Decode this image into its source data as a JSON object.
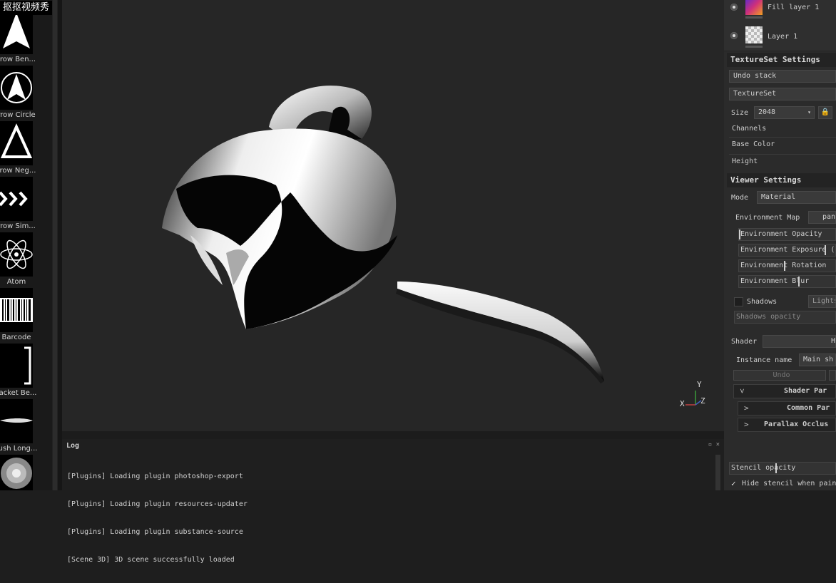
{
  "watermark": "抠抠视频秀",
  "shelf": {
    "items": [
      {
        "label": "rrow Ben...",
        "icon": "arrow-bend-icon"
      },
      {
        "label": "rrow Circle",
        "icon": "arrow-circle-icon"
      },
      {
        "label": "rrow Neg...",
        "icon": "arrow-negative-icon"
      },
      {
        "label": "rrow Sim...",
        "icon": "arrow-simple-icon"
      },
      {
        "label": "Atom",
        "icon": "atom-icon"
      },
      {
        "label": "Barcode",
        "icon": "barcode-icon"
      },
      {
        "label": "racket Be...",
        "icon": "bracket-icon"
      },
      {
        "label": "rush Long...",
        "icon": "brush-long-icon"
      },
      {
        "label": "",
        "icon": "brush-round-icon"
      }
    ]
  },
  "viewport": {
    "axis_labels": {
      "y": "Y",
      "x": "X",
      "z": "Z"
    }
  },
  "log": {
    "title": "Log",
    "buttons": "▫ ×",
    "lines": [
      "[Plugins] Loading plugin photoshop-export",
      "[Plugins] Loading plugin resources-updater",
      "[Plugins] Loading plugin substance-source",
      "[Scene 3D] 3D scene successfully loaded"
    ]
  },
  "layers": [
    {
      "name": "Fill layer 1",
      "icon": "fill-layer-icon"
    },
    {
      "name": "Layer 1",
      "icon": "paint-layer-icon"
    }
  ],
  "textureset": {
    "title": "TextureSet Settings",
    "undo_stack": "Undo stack",
    "textureset": "TextureSet",
    "size_label": "Size",
    "size_value": "2048",
    "channels": "Channels",
    "base_color": "Base Color",
    "height": "Height"
  },
  "viewer": {
    "title": "Viewer Settings",
    "mode_label": "Mode",
    "mode_value": "Material",
    "env_map_label": "Environment Map",
    "env_map_value": "pan",
    "env_opacity": "Environment Opacity",
    "env_exposure": "Environment Exposure (",
    "env_rotation": "Environment Rotation",
    "env_blur": "Environment Blur",
    "shadows": "Shadows",
    "lights": "Lights",
    "shadows_opacity": "Shadows opacity",
    "shader_label": "Shader",
    "shader_value": "H",
    "instance_label": "Instance name",
    "instance_value": "Main sh",
    "undo": "Undo",
    "shader_params": "Shader Par",
    "common_params": "Common Par",
    "parallax": "Parallax Occlus",
    "stencil_opacity": "Stencil opacity",
    "hide_stencil": "Hide stencil when pain"
  }
}
